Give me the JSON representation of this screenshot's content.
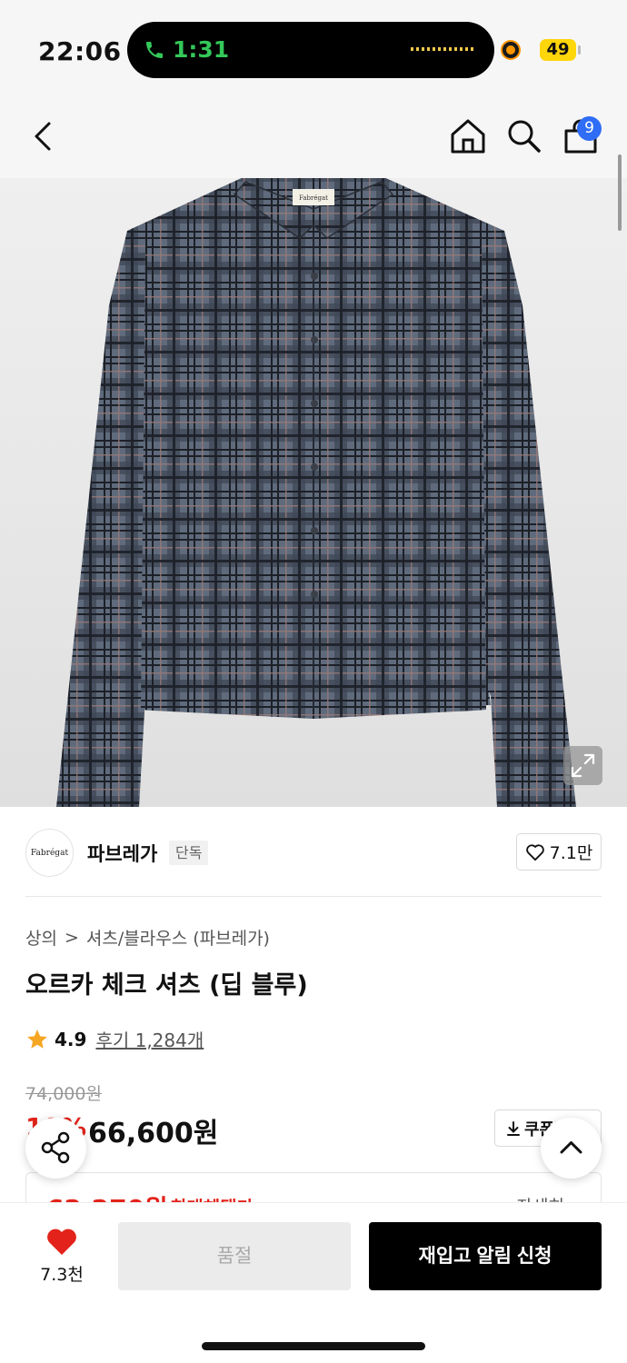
{
  "status_bar": {
    "time": "22:06",
    "call_time": "1:31",
    "battery": "49"
  },
  "nav": {
    "cart_count": "9"
  },
  "product_image": {
    "brand_label": "Fabrégat"
  },
  "brand": {
    "logo_text": "Fabrégat",
    "name": "파브레가",
    "tag": "단독",
    "likes": "7.1만"
  },
  "breadcrumb": {
    "category": "상의",
    "separator": ">",
    "subcategory": "셔츠/블라우스 (파브레가)"
  },
  "product": {
    "title": "오르카 체크 셔츠 (딥 블루)",
    "rating": "4.9",
    "reviews": "후기 1,284개",
    "original_price": "74,000원",
    "discount": "10%",
    "price": "66,600원",
    "coupon_label": "쿠폰받기"
  },
  "benefit": {
    "price": "62,270원",
    "label": "최대혜택가",
    "detail": "자세히"
  },
  "bottom_bar": {
    "wish_count": "7.3천",
    "soldout_label": "품절",
    "restock_label": "재입고 알림 신청"
  },
  "colors": {
    "accent_red": "#e3231b",
    "badge_blue": "#2f6df6",
    "call_green": "#34c759",
    "star": "#f5a623"
  }
}
